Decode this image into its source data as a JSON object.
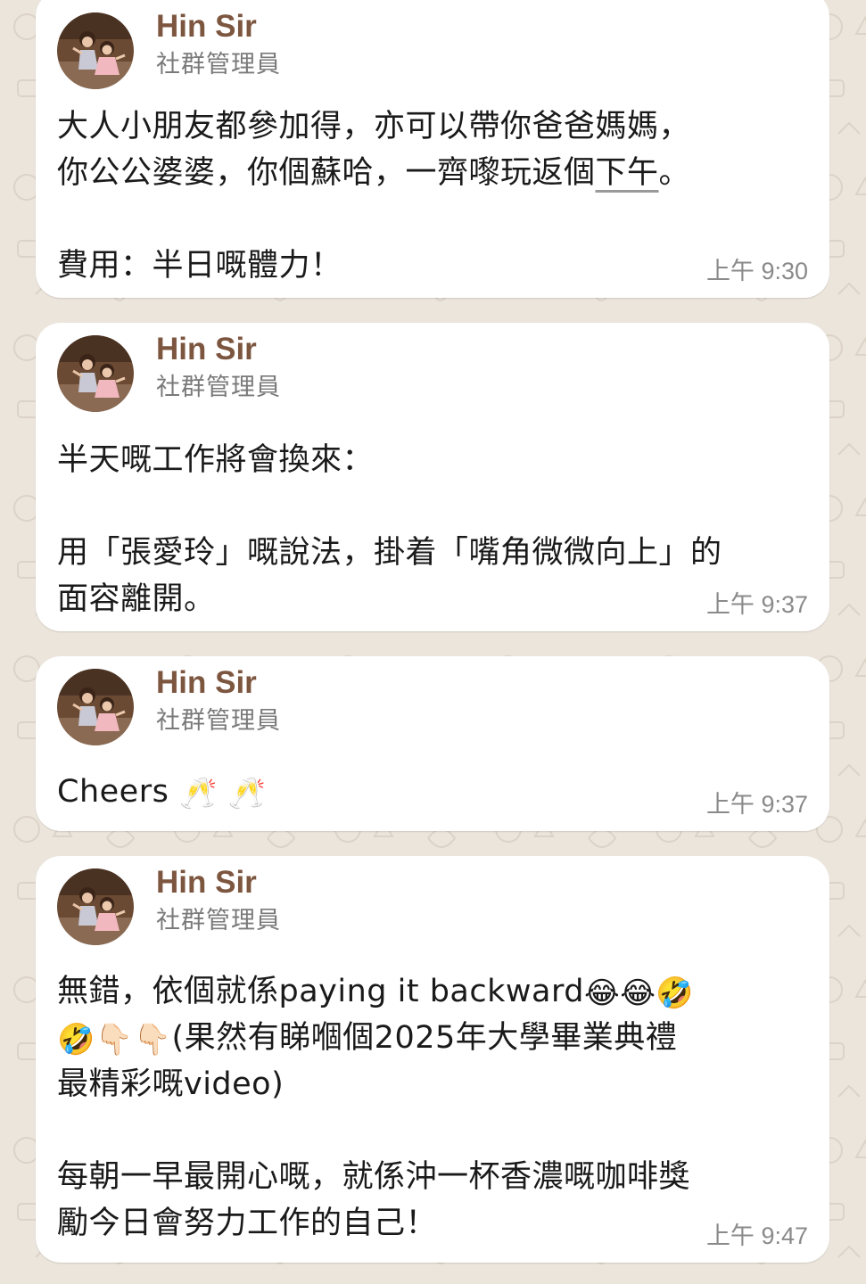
{
  "messages": [
    {
      "sender": "Hin Sir",
      "role": "社群管理員",
      "lines": [
        "大人小朋友都參加得，亦可以帶你爸爸媽媽，",
        "你公公婆婆，你個蘇哈，一齊嚟玩返個",
        "下午",
        "。",
        "",
        "費用：半日嘅體力！"
      ],
      "time": "上午 9:30"
    },
    {
      "sender": "Hin Sir",
      "role": "社群管理員",
      "lines": [
        "半天嘅工作將會換來：",
        "",
        "用「張愛玲」嘅說法，掛着「嘴角微微向上」的",
        "面容離開。"
      ],
      "time": "上午 9:37"
    },
    {
      "sender": "Hin Sir",
      "role": "社群管理員",
      "text": "Cheers",
      "emojis": [
        "🥂",
        "🥂"
      ],
      "time": "上午 9:37"
    },
    {
      "sender": "Hin Sir",
      "role": "社群管理員",
      "line1_text": "無錯，依個就係paying it backward",
      "line1_emojis": [
        "😂",
        "😂",
        "🤣"
      ],
      "line2_emojis": [
        "🤣",
        "👇🏻",
        "👇🏻"
      ],
      "line2_text": "(果然有睇嗰個2025年大學畢業典禮",
      "line3": "最精彩嘅video)",
      "line5": "每朝一早最開心嘅，就係沖一杯香濃嘅咖啡獎",
      "line6": "勵今日會努力工作的自己！",
      "time": "上午 9:47"
    }
  ],
  "colors": {
    "wallpaper": "#ece5dc",
    "bubble": "#ffffff",
    "sender_name": "#7d5640",
    "role": "#7a7a7a",
    "body_text": "#1a1a1a",
    "time": "#8a8a8a"
  }
}
